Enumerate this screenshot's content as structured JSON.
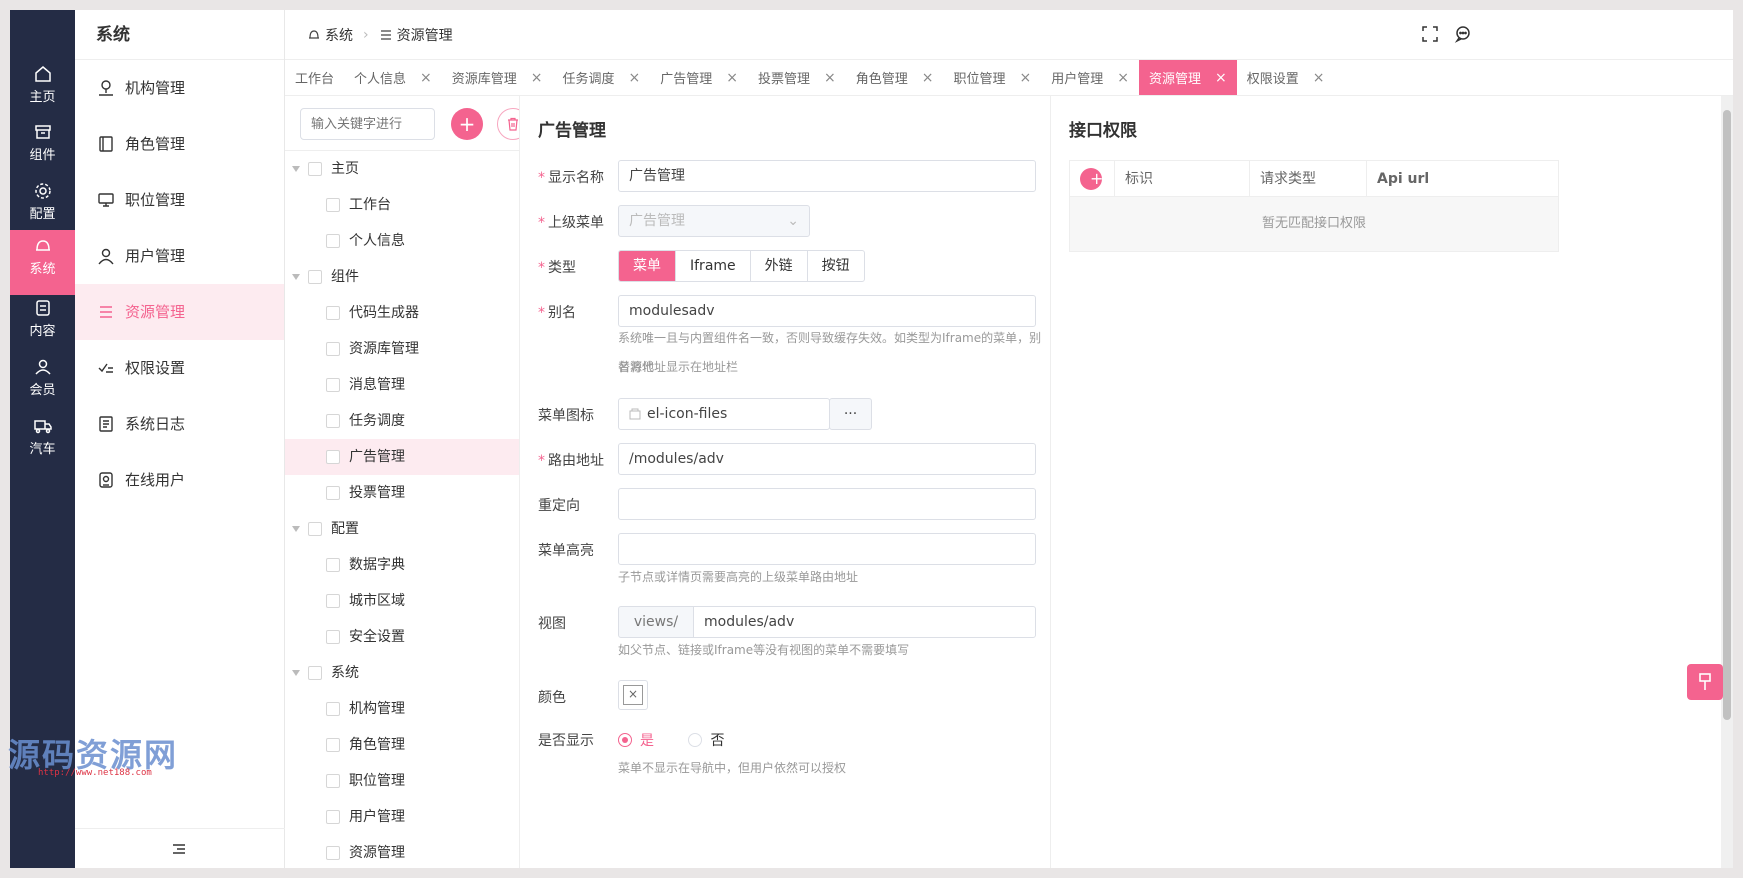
{
  "rail": [
    {
      "label": "主页",
      "icon": "home-icon"
    },
    {
      "label": "组件",
      "icon": "box-icon"
    },
    {
      "label": "配置",
      "icon": "gear-icon"
    },
    {
      "label": "系统",
      "icon": "bell-icon",
      "active": true
    },
    {
      "label": "内容",
      "icon": "content-icon"
    },
    {
      "label": "会员",
      "icon": "user-icon"
    },
    {
      "label": "汽车",
      "icon": "truck-icon"
    }
  ],
  "subnav": {
    "title": "系统",
    "items": [
      {
        "label": "机构管理"
      },
      {
        "label": "角色管理"
      },
      {
        "label": "职位管理"
      },
      {
        "label": "用户管理"
      },
      {
        "label": "资源管理",
        "active": true
      },
      {
        "label": "权限设置"
      },
      {
        "label": "系统日志"
      },
      {
        "label": "在线用户"
      }
    ]
  },
  "breadcrumb": {
    "root": "系统",
    "current": "资源管理"
  },
  "tabs": [
    {
      "label": "工作台",
      "closable": false
    },
    {
      "label": "个人信息",
      "closable": true
    },
    {
      "label": "资源库管理",
      "closable": true
    },
    {
      "label": "任务调度",
      "closable": true
    },
    {
      "label": "广告管理",
      "closable": true
    },
    {
      "label": "投票管理",
      "closable": true
    },
    {
      "label": "角色管理",
      "closable": true
    },
    {
      "label": "职位管理",
      "closable": true
    },
    {
      "label": "用户管理",
      "closable": true
    },
    {
      "label": "资源管理",
      "closable": true,
      "active": true
    },
    {
      "label": "权限设置",
      "closable": true
    }
  ],
  "tree": {
    "search_placeholder": "输入关键字进行",
    "nodes": [
      {
        "label": "主页",
        "level": 1
      },
      {
        "label": "工作台",
        "level": 2
      },
      {
        "label": "个人信息",
        "level": 2
      },
      {
        "label": "组件",
        "level": 1
      },
      {
        "label": "代码生成器",
        "level": 2
      },
      {
        "label": "资源库管理",
        "level": 2
      },
      {
        "label": "消息管理",
        "level": 2
      },
      {
        "label": "任务调度",
        "level": 2
      },
      {
        "label": "广告管理",
        "level": 2,
        "selected": true
      },
      {
        "label": "投票管理",
        "level": 2
      },
      {
        "label": "配置",
        "level": 1
      },
      {
        "label": "数据字典",
        "level": 2
      },
      {
        "label": "城市区域",
        "level": 2
      },
      {
        "label": "安全设置",
        "level": 2
      },
      {
        "label": "系统",
        "level": 1
      },
      {
        "label": "机构管理",
        "level": 2
      },
      {
        "label": "角色管理",
        "level": 2
      },
      {
        "label": "职位管理",
        "level": 2
      },
      {
        "label": "用户管理",
        "level": 2
      },
      {
        "label": "资源管理",
        "level": 2
      }
    ]
  },
  "form": {
    "title": "广告管理",
    "display_name": {
      "label": "显示名称",
      "value": "广告管理"
    },
    "parent_menu": {
      "label": "上级菜单",
      "value": "广告管理"
    },
    "type": {
      "label": "类型",
      "options": [
        "菜单",
        "Iframe",
        "外链",
        "按钮"
      ],
      "selected": "菜单"
    },
    "alias": {
      "label": "别名",
      "value": "modulesadv",
      "hint1": "系统唯一且与内置组件名一致，否则导致缓存失效。如类型为Iframe的菜单，别名将代",
      "hint2": "替源地址显示在地址栏"
    },
    "menu_icon": {
      "label": "菜单图标",
      "value": "el-icon-files",
      "more": "···"
    },
    "route": {
      "label": "路由地址",
      "value": "/modules/adv"
    },
    "redirect": {
      "label": "重定向",
      "value": ""
    },
    "highlight": {
      "label": "菜单高亮",
      "value": "",
      "hint": "子节点或详情页需要高亮的上级菜单路由地址"
    },
    "view": {
      "label": "视图",
      "prefix": "views/",
      "value": "modules/adv",
      "hint": "如父节点、链接或Iframe等没有视图的菜单不需要填写"
    },
    "color": {
      "label": "颜色"
    },
    "visible": {
      "label": "是否显示",
      "yes": "是",
      "no": "否",
      "selected": "是",
      "hint": "菜单不显示在导航中，但用户依然可以授权"
    }
  },
  "api": {
    "title": "接口权限",
    "columns": [
      "标识",
      "请求类型",
      "Api url"
    ],
    "empty_text": "暂无匹配接口权限"
  },
  "watermark": {
    "text": "源码资源网",
    "url": "http://www.net188.com"
  },
  "colors": {
    "accent": "#f4638f",
    "rail_bg": "#242c45"
  }
}
